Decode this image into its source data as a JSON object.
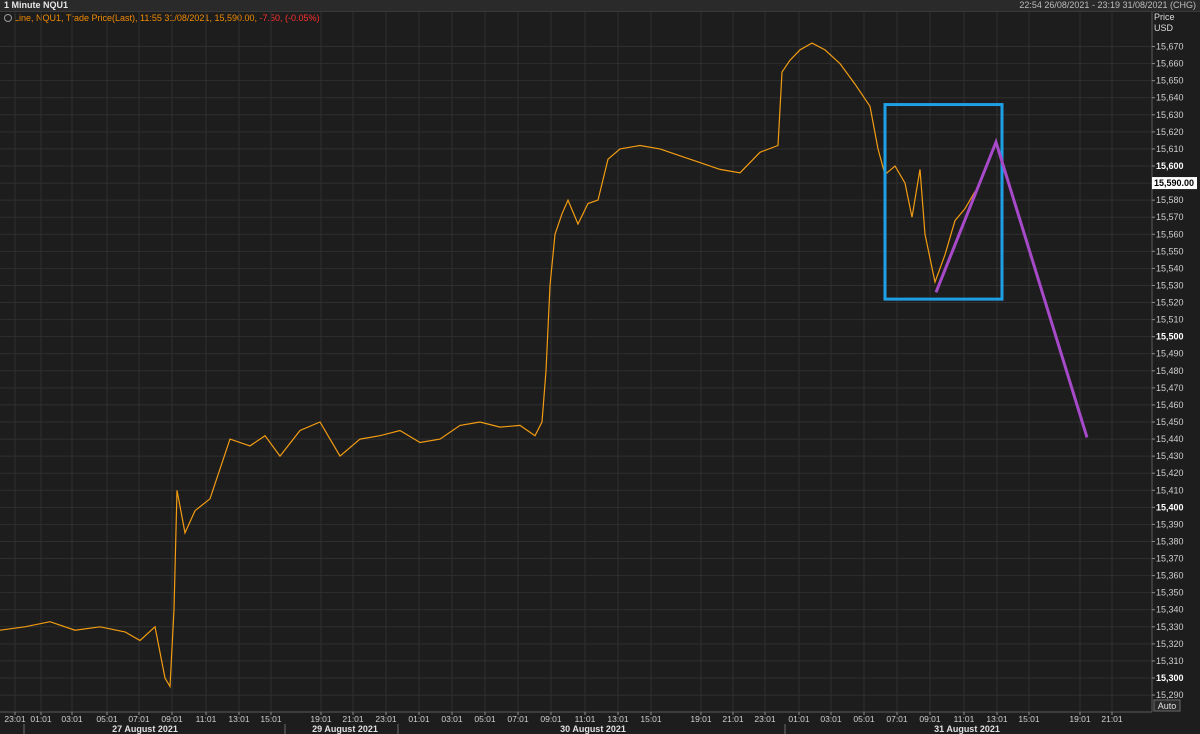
{
  "header": {
    "title": "1 Minute NQU1",
    "range": "22:54 26/08/2021 - 23:19 31/08/2021 (CHG)"
  },
  "legend": {
    "text": "Line, NQU1, Trade Price(Last),  11:55 31/08/2021, 15,590.00, ",
    "change": "-7.50, (-0.05%)"
  },
  "axis": {
    "price_label": "Price",
    "currency_label": "USD",
    "auto_button": "Auto"
  },
  "colors": {
    "background": "#1d1d1d",
    "line": "#f39c12",
    "box": "#1ea0e6",
    "projection": "#a64ac9",
    "grid": "#2f2f2f"
  },
  "chart_data": {
    "type": "line",
    "title": "",
    "ylabel": "Price USD",
    "ylim": [
      15285,
      15680
    ],
    "ytick_step": 10,
    "ytick_bold_every": 100,
    "current_price": "15,590.00",
    "xtick_labels": [
      "23:01",
      "01:01",
      "03:01",
      "05:01",
      "07:01",
      "09:01",
      "11:01",
      "13:01",
      "15:01",
      "19:01",
      "21:01",
      "23:01",
      "01:01",
      "03:01",
      "05:01",
      "07:01",
      "09:01",
      "11:01",
      "13:01",
      "15:01",
      "19:01",
      "21:01",
      "23:01",
      "01:01",
      "03:01",
      "05:01",
      "07:01",
      "09:01",
      "11:01",
      "13:01",
      "15:01",
      "19:01",
      "21:01"
    ],
    "date_labels": [
      "27 August 2021",
      "29 August 2021",
      "30 August 2021",
      "31 August 2021"
    ],
    "series": [
      {
        "values": [
          [
            0,
            15328
          ],
          [
            25,
            15330
          ],
          [
            50,
            15333
          ],
          [
            75,
            15328
          ],
          [
            100,
            15330
          ],
          [
            125,
            15327
          ],
          [
            140,
            15322
          ],
          [
            155,
            15330
          ],
          [
            165,
            15300
          ],
          [
            170,
            15295
          ],
          [
            174,
            15340
          ],
          [
            177,
            15410
          ],
          [
            185,
            15385
          ],
          [
            195,
            15398
          ],
          [
            210,
            15405
          ],
          [
            230,
            15440
          ],
          [
            250,
            15436
          ],
          [
            265,
            15442
          ],
          [
            280,
            15430
          ],
          [
            300,
            15445
          ],
          [
            320,
            15450
          ],
          [
            340,
            15430
          ],
          [
            360,
            15440
          ],
          [
            380,
            15442
          ],
          [
            400,
            15445
          ],
          [
            420,
            15438
          ],
          [
            440,
            15440
          ],
          [
            460,
            15448
          ],
          [
            480,
            15450
          ],
          [
            500,
            15447
          ],
          [
            520,
            15448
          ],
          [
            535,
            15442
          ],
          [
            542,
            15450
          ],
          [
            546,
            15480
          ],
          [
            550,
            15530
          ],
          [
            555,
            15560
          ],
          [
            562,
            15572
          ],
          [
            568,
            15580
          ],
          [
            578,
            15566
          ],
          [
            588,
            15578
          ],
          [
            598,
            15580
          ],
          [
            608,
            15604
          ],
          [
            620,
            15610
          ],
          [
            640,
            15612
          ],
          [
            660,
            15610
          ],
          [
            680,
            15606
          ],
          [
            700,
            15602
          ],
          [
            720,
            15598
          ],
          [
            740,
            15596
          ],
          [
            760,
            15608
          ],
          [
            778,
            15612
          ],
          [
            782,
            15655
          ],
          [
            790,
            15662
          ],
          [
            800,
            15668
          ],
          [
            812,
            15672
          ],
          [
            825,
            15668
          ],
          [
            840,
            15660
          ],
          [
            855,
            15648
          ],
          [
            870,
            15635
          ],
          [
            878,
            15610
          ],
          [
            885,
            15595
          ],
          [
            895,
            15600
          ],
          [
            905,
            15590
          ],
          [
            912,
            15570
          ],
          [
            920,
            15598
          ],
          [
            925,
            15560
          ],
          [
            935,
            15532
          ],
          [
            945,
            15548
          ],
          [
            955,
            15568
          ],
          [
            965,
            15575
          ],
          [
            975,
            15585
          ]
        ]
      }
    ],
    "annotations": [
      {
        "type": "rectangle",
        "label": "",
        "x_range": [
          885,
          1002
        ],
        "y_range": [
          15522,
          15636
        ]
      },
      {
        "type": "projection-line",
        "label": "",
        "points": [
          [
            936,
            15526
          ],
          [
            996,
            15614
          ],
          [
            1087,
            15441
          ]
        ]
      }
    ]
  }
}
